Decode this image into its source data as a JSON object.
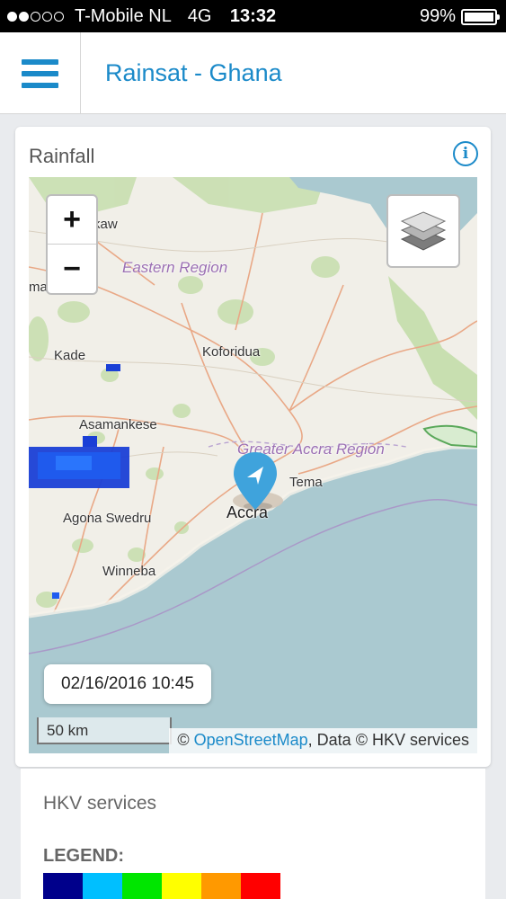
{
  "status_bar": {
    "carrier": "T-Mobile NL",
    "network": "4G",
    "time": "13:32",
    "battery": "99%",
    "battery_level": 0.99,
    "signal_bars_filled": 2,
    "signal_bars_total": 5
  },
  "header": {
    "title": "Rainsat - Ghana",
    "menu_icon": "hamburger-menu-icon"
  },
  "rainfall_card": {
    "title": "Rainfall",
    "info_icon": "info-icon",
    "map": {
      "zoom_in": "+",
      "zoom_out": "−",
      "layers_icon": "layers-icon",
      "timestamp": "02/16/2016 10:45",
      "scale": "50 km",
      "attribution_prefix": "© ",
      "attribution_link": "OpenStreetMap",
      "attribution_suffix": ", Data © HKV services",
      "labels": {
        "eastern_region": "Eastern Region",
        "greater_accra_region": "Greater Accra Region",
        "koforidua": "Koforidua",
        "kade": "Kade",
        "asamankese": "Asamankese",
        "tema": "Tema",
        "accra": "Accra",
        "agona_swedru": "Agona Swedru",
        "winneba": "Winneba",
        "kaw": "kaw",
        "ma": "ma"
      }
    }
  },
  "info_card": {
    "title": "HKV services",
    "legend_title": "LEGEND:",
    "legend_colors": [
      "#00008b",
      "#00bfff",
      "#00e600",
      "#ffff00",
      "#ff9900",
      "#ff0000"
    ]
  },
  "colors": {
    "accent": "#1b8ac9",
    "sea": "#aac9d0",
    "land": "#f1efe8"
  }
}
